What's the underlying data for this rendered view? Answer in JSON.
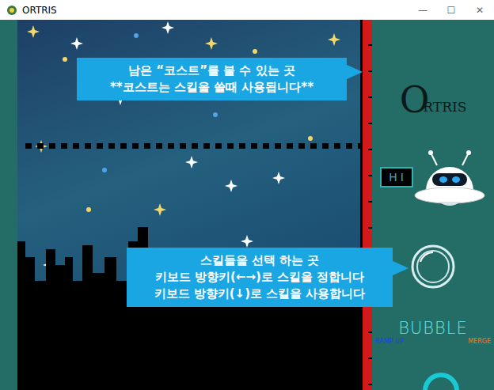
{
  "window": {
    "title": "ORTRIS",
    "controls": [
      "—",
      "☐",
      "✕"
    ]
  },
  "cost_gauge": {
    "level": 1
  },
  "logo": {
    "initial": "O",
    "rest": "RTRIS"
  },
  "robot": {
    "sign": "HI"
  },
  "skills": {
    "current": "BUBBLE",
    "items": [
      {
        "label": "RAMP UP",
        "selected": false,
        "color": "#1a3cff"
      },
      {
        "label": "MERGE",
        "selected": false,
        "color": "#f07a1a"
      }
    ]
  },
  "callouts": [
    {
      "lines": [
        "남은 “코스트”를 볼 수 있는 곳",
        "**코스트는 스킬을 쓸때 사용됩니다**"
      ]
    },
    {
      "lines": [
        "스킬들을 선택 하는 곳",
        "키보드 방향키(←→)로 스킬을 정합니다",
        "키보드 방향키(↓)로 스킬을 사용합니다"
      ]
    }
  ]
}
